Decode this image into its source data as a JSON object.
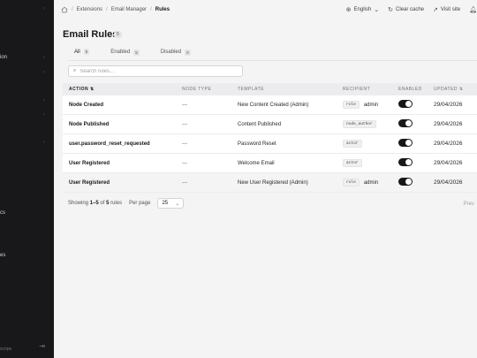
{
  "sidebar": {
    "fragments": [
      "ion",
      "cs",
      "es"
    ],
    "footer_text": "scope"
  },
  "breadcrumb": {
    "items": [
      "Extensions",
      "Email Manager"
    ],
    "current": "Rules"
  },
  "topbar": {
    "language": "English",
    "clear_cache": "Clear cache",
    "visit_site": "Visit site"
  },
  "page": {
    "title": "Email Rules",
    "count": "5"
  },
  "tabs": [
    {
      "label": "All",
      "count": "5"
    },
    {
      "label": "Enabled",
      "count": "5"
    },
    {
      "label": "Disabled",
      "count": "0"
    }
  ],
  "search": {
    "placeholder": "Search rules..."
  },
  "table": {
    "headers": {
      "action": "ACTION ⇅",
      "node_type": "NODE TYPE",
      "template": "TEMPLATE",
      "recipient": "RECIPIENT",
      "enabled": "ENABLED",
      "updated": "UPDATED ⇅"
    },
    "rows": [
      {
        "action": "Node Created",
        "node_type": "—",
        "template": "New Content Created (Admin)",
        "recipient_chip": "role",
        "recipient_text": "admin",
        "enabled": true,
        "updated": "29/04/2026"
      },
      {
        "action": "Node Published",
        "node_type": "—",
        "template": "Content Published",
        "recipient_chip": "node_author",
        "recipient_text": "",
        "enabled": true,
        "updated": "29/04/2026"
      },
      {
        "action": "user.password_reset_requested",
        "node_type": "—",
        "template": "Password Reset",
        "recipient_chip": "actor",
        "recipient_text": "",
        "enabled": true,
        "updated": "29/04/2026"
      },
      {
        "action": "User Registered",
        "node_type": "—",
        "template": "Welcome Email",
        "recipient_chip": "actor",
        "recipient_text": "",
        "enabled": true,
        "updated": "29/04/2026"
      },
      {
        "action": "User Registered",
        "node_type": "—",
        "template": "New User Registered (Admin)",
        "recipient_chip": "role",
        "recipient_text": "admin",
        "enabled": true,
        "updated": "29/04/2026"
      }
    ]
  },
  "footer": {
    "showing_prefix": "Showing",
    "range": "1–5",
    "of": "of",
    "total": "5",
    "suffix": "rules",
    "per_page_label": "Per page",
    "per_page_value": "25",
    "prev": "Prev"
  },
  "colors": {
    "sidebar_bg": "#18181b",
    "page_bg": "#f4f4f5",
    "toggle_on": "#18181b"
  }
}
